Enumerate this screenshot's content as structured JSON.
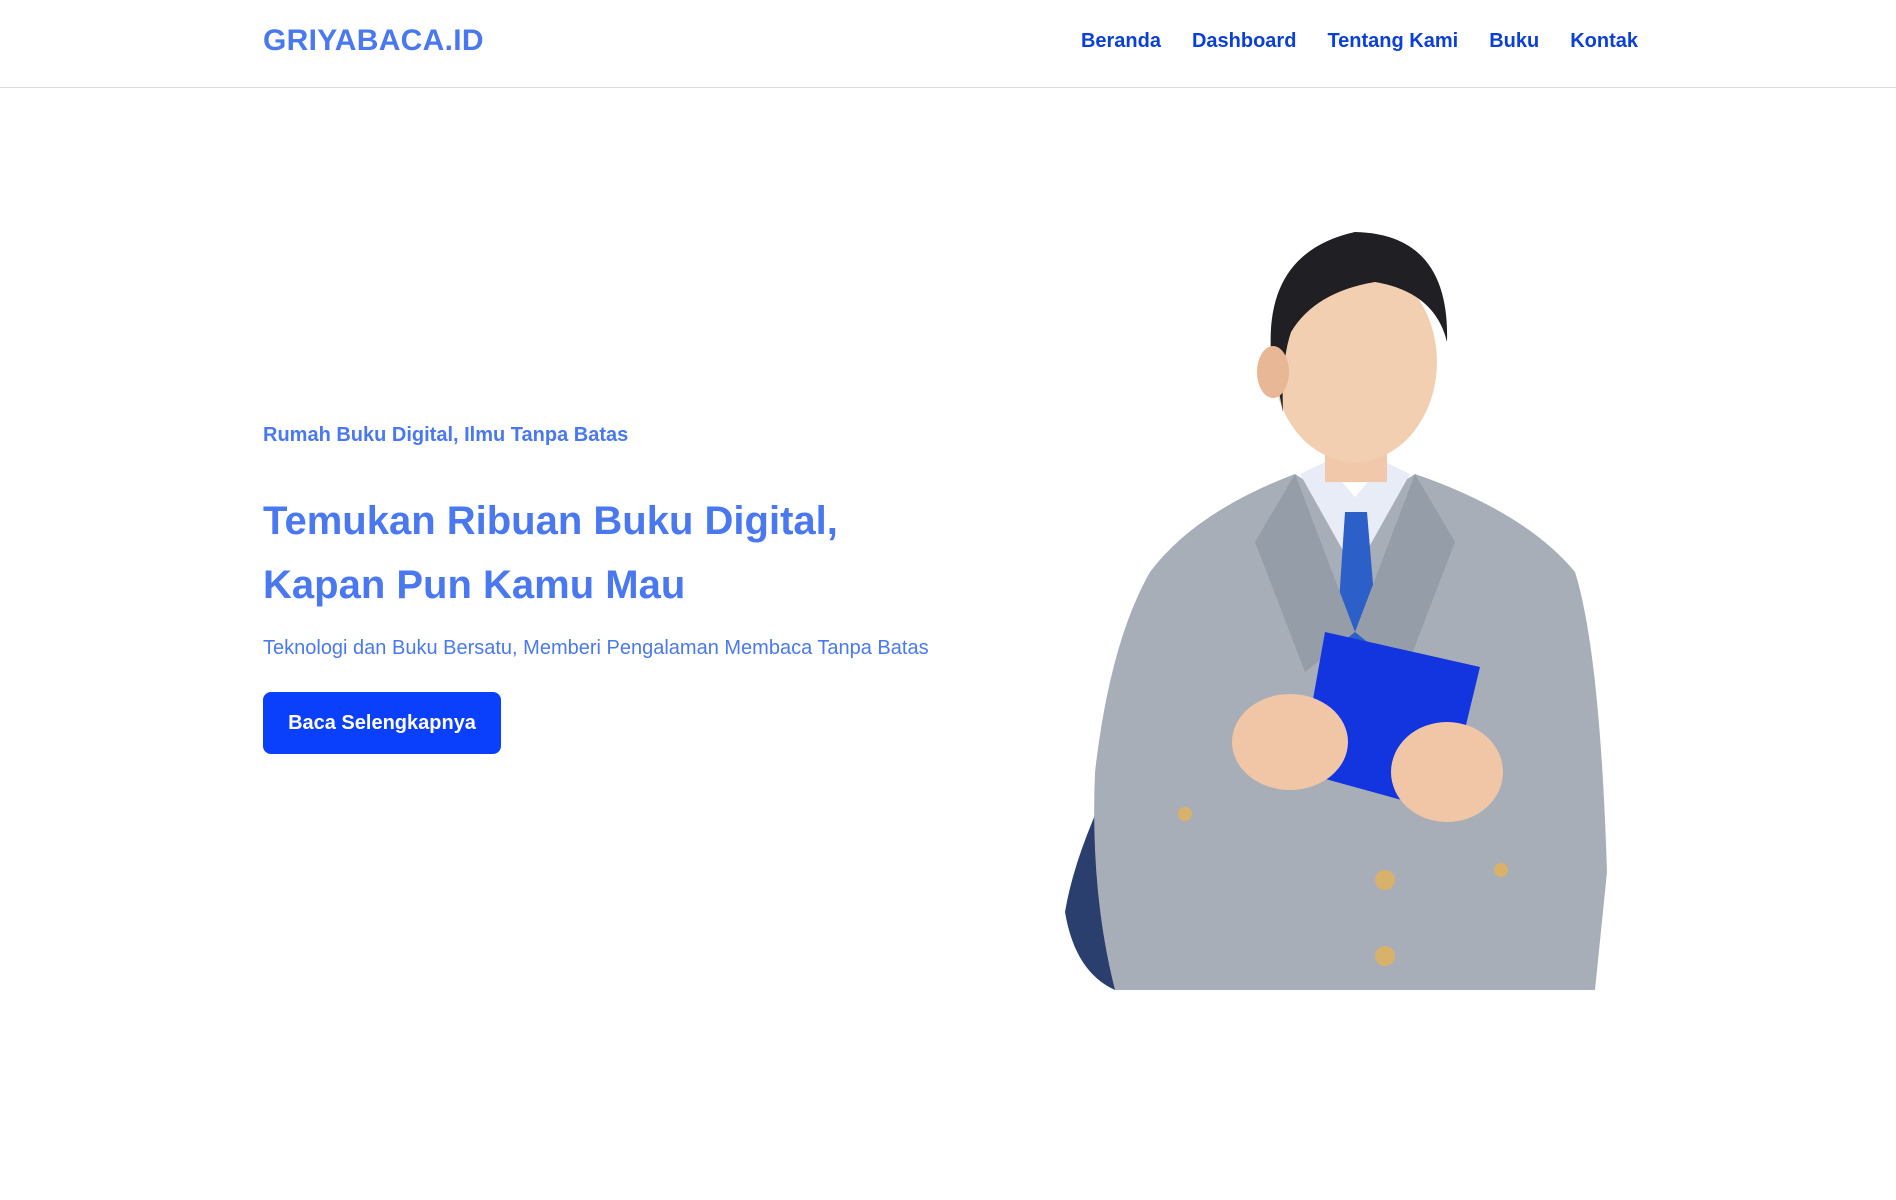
{
  "brand": {
    "name": "GRIYABACA.ID"
  },
  "nav": {
    "items": [
      {
        "label": "Beranda"
      },
      {
        "label": "Dashboard"
      },
      {
        "label": "Tentang Kami"
      },
      {
        "label": "Buku"
      },
      {
        "label": "Kontak"
      }
    ]
  },
  "hero": {
    "tagline": "Rumah Buku Digital, Ilmu Tanpa Batas",
    "headline_line1": "Temukan Ribuan Buku Digital,",
    "headline_line2": "Kapan Pun Kamu Mau",
    "subtitle": "Teknologi dan Buku Bersatu, Memberi Pengalaman Membaca Tanpa Batas",
    "cta_label": "Baca Selengkapnya"
  },
  "colors": {
    "accent": "#4a78f0",
    "nav_link": "#0a3fd8",
    "button": "#0a3ffb"
  }
}
